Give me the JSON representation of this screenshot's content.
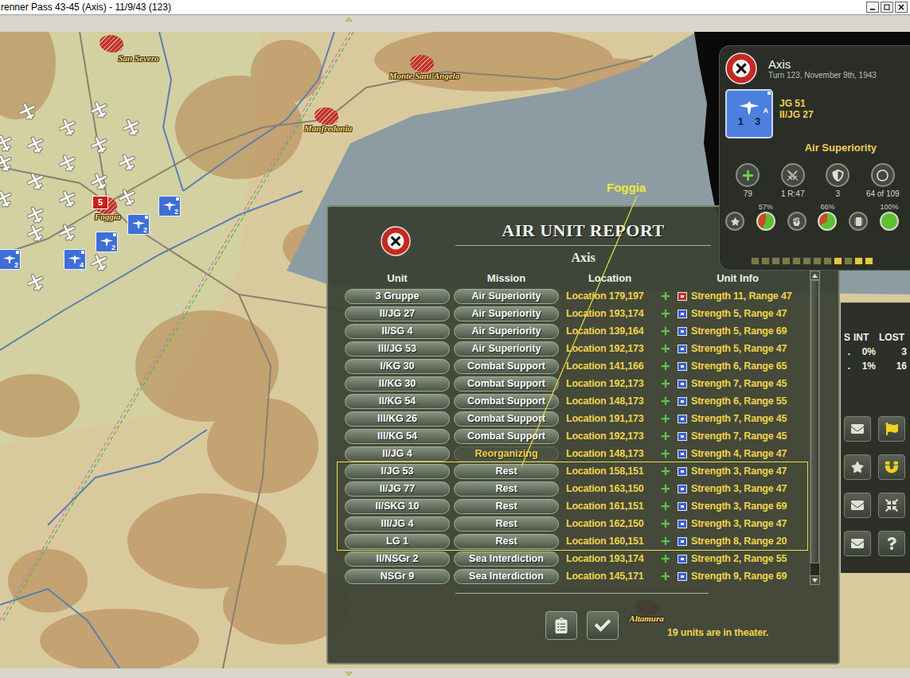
{
  "window": {
    "title": "renner Pass 43-45 (Axis) - 11/9/43 (123)"
  },
  "map": {
    "cities": [
      {
        "name": "San Severo"
      },
      {
        "name": "Monte Sant'Angelo"
      },
      {
        "name": "Manfredonia"
      },
      {
        "name": "Foggia",
        "badge": "5"
      },
      {
        "name": "Altamura"
      }
    ],
    "counters": [
      {
        "value": "2"
      },
      {
        "value": "2"
      },
      {
        "value": "2"
      },
      {
        "value": "4"
      },
      {
        "value": "2"
      }
    ],
    "annotation": {
      "label": "Foggia"
    }
  },
  "side_panel": {
    "side": "Axis",
    "turn": "Turn 123, November 9th, 1943",
    "unit": {
      "name": "JG 51",
      "sub": "II/JG 27",
      "attack": "1",
      "defense": "3",
      "type": "A"
    },
    "mission": "Air Superiority",
    "stats": [
      {
        "value": "79"
      },
      {
        "value": "1 R:47"
      },
      {
        "value": "3"
      },
      {
        "value": "64 of 109"
      }
    ],
    "gauges": [
      {
        "reading": "57%",
        "level": 0.57
      },
      {
        "reading": "66%",
        "level": 0.66
      },
      {
        "reading": "100%",
        "level": 1
      }
    ],
    "pips": [
      false,
      false,
      false,
      false,
      false,
      false,
      false,
      false,
      true,
      false,
      true,
      true
    ]
  },
  "stats_panel": {
    "columns": [
      "S",
      "INT",
      "LOST"
    ],
    "rows": [
      [
        ".",
        "0%",
        "3"
      ],
      [
        ".",
        "1%",
        "16"
      ]
    ]
  },
  "report": {
    "title": "AIR UNIT REPORT",
    "side": "Axis",
    "columns": [
      "Unit",
      "Mission",
      "Location",
      "Unit Info"
    ],
    "rows": [
      {
        "unit": "3 Gruppe",
        "mission": "Air Superiority",
        "location": "Location 179,197",
        "info": "Strength 11, Range 47",
        "color": "#c8302c",
        "highlighted": false,
        "annotated": false
      },
      {
        "unit": "II/JG 27",
        "mission": "Air Superiority",
        "location": "Location 193,174",
        "info": "Strength 5, Range 47",
        "color": "#3a5fd0",
        "highlighted": false,
        "annotated": false
      },
      {
        "unit": "II/SG 4",
        "mission": "Air Superiority",
        "location": "Location 139,164",
        "info": "Strength 5, Range 69",
        "color": "#3a5fd0",
        "highlighted": false,
        "annotated": false
      },
      {
        "unit": "III/JG 53",
        "mission": "Air Superiority",
        "location": "Location 192,173",
        "info": "Strength 5, Range 47",
        "color": "#3a5fd0",
        "highlighted": false,
        "annotated": false
      },
      {
        "unit": "I/KG 30",
        "mission": "Combat Support",
        "location": "Location 141,166",
        "info": "Strength 6, Range 65",
        "color": "#3a5fd0",
        "highlighted": false,
        "annotated": false
      },
      {
        "unit": "II/KG 30",
        "mission": "Combat Support",
        "location": "Location 192,173",
        "info": "Strength 7, Range 45",
        "color": "#3a5fd0",
        "highlighted": false,
        "annotated": false
      },
      {
        "unit": "II/KG 54",
        "mission": "Combat Support",
        "location": "Location 148,173",
        "info": "Strength 6, Range 55",
        "color": "#3a5fd0",
        "highlighted": false,
        "annotated": false
      },
      {
        "unit": "III/KG 26",
        "mission": "Combat Support",
        "location": "Location 191,173",
        "info": "Strength 7, Range 45",
        "color": "#3a5fd0",
        "highlighted": false,
        "annotated": false
      },
      {
        "unit": "III/KG 54",
        "mission": "Combat Support",
        "location": "Location 192,173",
        "info": "Strength 7, Range 45",
        "color": "#3a5fd0",
        "highlighted": false,
        "annotated": false
      },
      {
        "unit": "II/JG 4",
        "mission": "Reorganizing",
        "location": "Location 148,173",
        "info": "Strength 4, Range 47",
        "color": "#3a5fd0",
        "highlighted": true,
        "annotated": false
      },
      {
        "unit": "I/JG 53",
        "mission": "Rest",
        "location": "Location 158,151",
        "info": "Strength 3, Range 47",
        "color": "#3a5fd0",
        "highlighted": false,
        "annotated": true
      },
      {
        "unit": "II/JG 77",
        "mission": "Rest",
        "location": "Location 163,150",
        "info": "Strength 3, Range 47",
        "color": "#3a5fd0",
        "highlighted": false,
        "annotated": true
      },
      {
        "unit": "II/SKG 10",
        "mission": "Rest",
        "location": "Location 161,151",
        "info": "Strength 3, Range 69",
        "color": "#3a5fd0",
        "highlighted": false,
        "annotated": true
      },
      {
        "unit": "III/JG 4",
        "mission": "Rest",
        "location": "Location 162,150",
        "info": "Strength 3, Range 47",
        "color": "#3a5fd0",
        "highlighted": false,
        "annotated": true
      },
      {
        "unit": "LG 1",
        "mission": "Rest",
        "location": "Location 160,151",
        "info": "Strength 8, Range 20",
        "color": "#3a5fd0",
        "highlighted": false,
        "annotated": true
      },
      {
        "unit": "II/NSGr 2",
        "mission": "Sea Interdiction",
        "location": "Location 193,174",
        "info": "Strength 2, Range 55",
        "color": "#3a5fd0",
        "highlighted": false,
        "annotated": false
      },
      {
        "unit": "NSGr 9",
        "mission": "Sea Interdiction",
        "location": "Location 145,171",
        "info": "Strength 9, Range 69",
        "color": "#3a5fd0",
        "highlighted": false,
        "annotated": false
      }
    ],
    "scrollbar": {
      "level": 0.96
    },
    "footer": "19 units are in theater."
  }
}
